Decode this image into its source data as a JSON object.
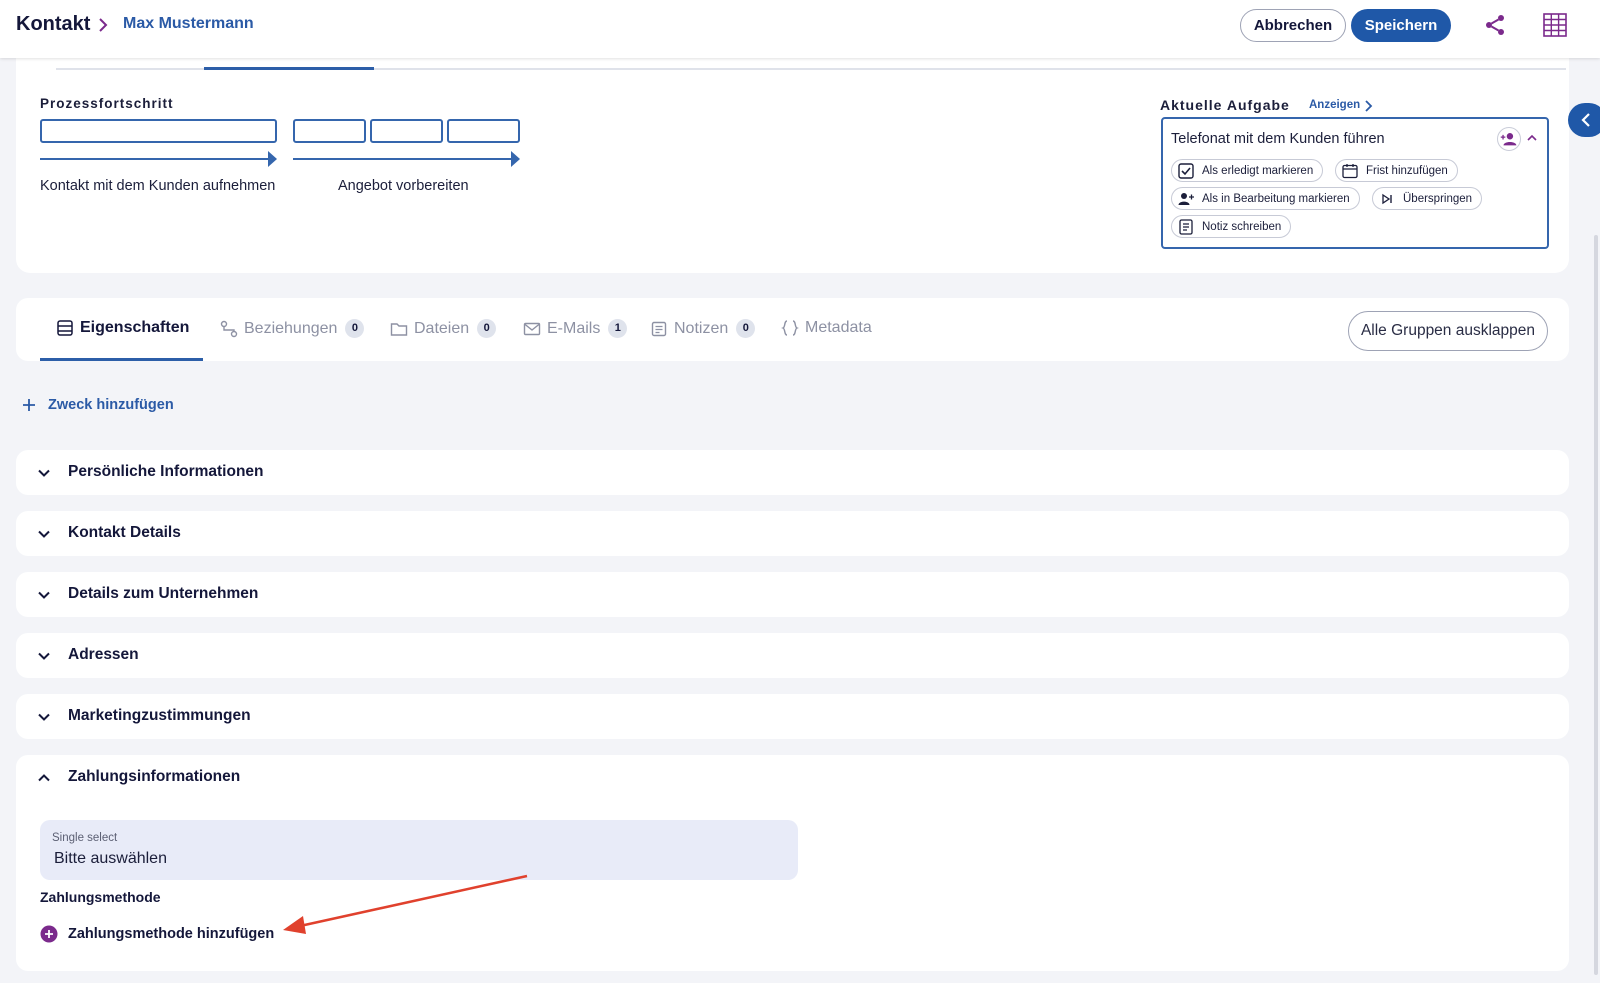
{
  "header": {
    "breadcrumb_root": "Kontakt",
    "breadcrumb_current": "Max Mustermann",
    "cancel_label": "Abbrechen",
    "save_label": "Speichern",
    "accent_color": "#1f58a8",
    "icons": [
      "chevron-right-icon",
      "share-icon",
      "grid-icon"
    ]
  },
  "process": {
    "title": "Prozessfortschritt",
    "stages": [
      {
        "label": "Kontakt mit dem Kunden aufnehmen",
        "segments": 1
      },
      {
        "label": "Angebot vorbereiten",
        "segments": 3
      }
    ]
  },
  "task": {
    "title": "Aktuelle Aufgabe",
    "link": "Anzeigen",
    "name": "Telefonat mit dem Kunden führen",
    "actions": [
      {
        "label": "Als erledigt markieren",
        "icon": "checkbox-icon"
      },
      {
        "label": "Frist hinzufügen",
        "icon": "calendar-icon"
      },
      {
        "label": "Als in Bearbeitung markieren",
        "icon": "user-plus-icon"
      },
      {
        "label": "Überspringen",
        "icon": "skip-icon"
      },
      {
        "label": "Notiz schreiben",
        "icon": "note-icon"
      }
    ]
  },
  "tabs": [
    {
      "label": "Eigenschaften",
      "icon": "properties-icon",
      "active": true
    },
    {
      "label": "Beziehungen",
      "icon": "relations-icon",
      "count": "0"
    },
    {
      "label": "Dateien",
      "icon": "folder-icon",
      "count": "0"
    },
    {
      "label": "E-Mails",
      "icon": "mail-icon",
      "count": "1"
    },
    {
      "label": "Notizen",
      "icon": "note-icon",
      "count": "0"
    },
    {
      "label": "Metadata",
      "icon": "braces-icon"
    }
  ],
  "expand_all_label": "Alle Gruppen ausklappen",
  "add_purpose_label": "Zweck hinzufügen",
  "groups": [
    {
      "label": "Persönliche Informationen"
    },
    {
      "label": "Kontakt Details"
    },
    {
      "label": "Details zum Unternehmen"
    },
    {
      "label": "Adressen"
    },
    {
      "label": "Marketingzustimmungen"
    }
  ],
  "payment": {
    "label": "Zahlungsinformationen",
    "select_caption": "Single select",
    "select_value": "Bitte auswählen",
    "field_label": "Zahlungsmethode",
    "add_label": "Zahlungsmethode hinzufügen",
    "add_icon_color": "#7b2a8c"
  },
  "annotation_color": "#e0412d"
}
